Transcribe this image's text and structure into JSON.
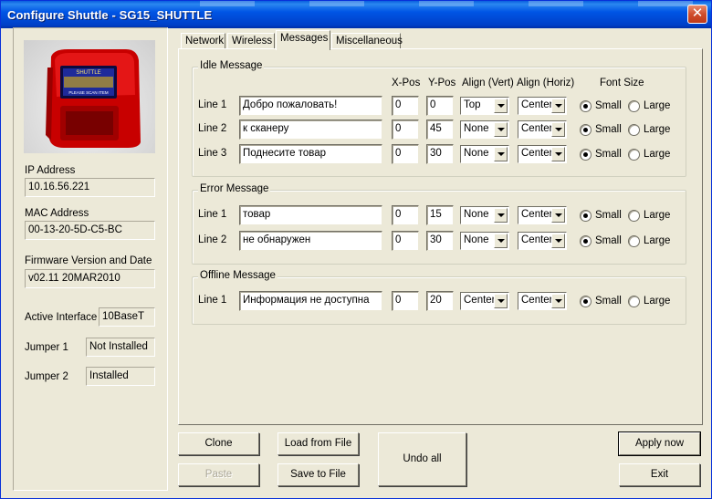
{
  "window": {
    "title": "Configure Shuttle - SG15_SHUTTLE",
    "close_label": "✕"
  },
  "device": {
    "ip_label": "IP Address",
    "ip_value": "10.16.56.221",
    "mac_label": "MAC Address",
    "mac_value": "00-13-20-5D-C5-BC",
    "fw_label": "Firmware Version and Date",
    "fw_value": "v02.11 20MAR2010",
    "iface_label": "Active Interface",
    "iface_value": "10BaseT",
    "j1_label": "Jumper 1",
    "j1_value": "Not Installed",
    "j2_label": "Jumper 2",
    "j2_value": "Installed",
    "screen_brand": "SHUTTLE",
    "screen_text": "PLEASE SCAN ITEM"
  },
  "tabs": [
    {
      "label": "Network"
    },
    {
      "label": "Wireless"
    },
    {
      "label": "Messages"
    },
    {
      "label": "Miscellaneous"
    }
  ],
  "columns": {
    "xpos": "X-Pos",
    "ypos": "Y-Pos",
    "valign": "Align (Vert)",
    "halign": "Align (Horiz)",
    "fontsize": "Font Size"
  },
  "radio_labels": {
    "small": "Small",
    "large": "Large"
  },
  "idle": {
    "legend": "Idle Message",
    "rows": [
      {
        "label": "Line 1",
        "text": "Добро пожаловать!",
        "x": "0",
        "y": "0",
        "valign": "Top",
        "halign": "Center",
        "font": "Small"
      },
      {
        "label": "Line 2",
        "text": "к сканеру",
        "x": "0",
        "y": "45",
        "valign": "None",
        "halign": "Center",
        "font": "Small"
      },
      {
        "label": "Line 3",
        "text": "Поднесите товар",
        "x": "0",
        "y": "30",
        "valign": "None",
        "halign": "Center",
        "font": "Small"
      }
    ]
  },
  "error": {
    "legend": "Error Message",
    "rows": [
      {
        "label": "Line 1",
        "text": "товар",
        "x": "0",
        "y": "15",
        "valign": "None",
        "halign": "Center",
        "font": "Small"
      },
      {
        "label": "Line 2",
        "text": "не обнаружен",
        "x": "0",
        "y": "30",
        "valign": "None",
        "halign": "Center",
        "font": "Small"
      }
    ]
  },
  "offline": {
    "legend": "Offline Message",
    "rows": [
      {
        "label": "Line 1",
        "text": "  Информация не доступна",
        "x": "0",
        "y": "20",
        "valign": "Center",
        "halign": "Center",
        "font": "Small"
      }
    ]
  },
  "buttons": {
    "clone": "Clone",
    "paste": "Paste",
    "load": "Load from File",
    "save": "Save to File",
    "undo": "Undo all",
    "apply": "Apply now",
    "exit": "Exit"
  }
}
